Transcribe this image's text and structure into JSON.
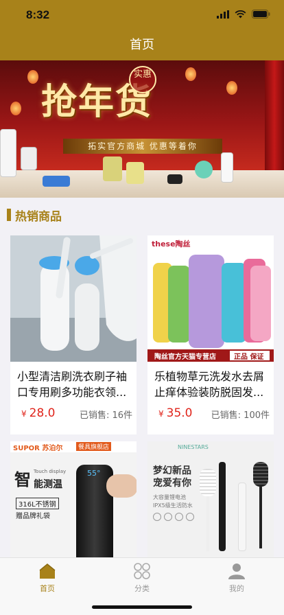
{
  "status_bar": {
    "time": "8:32"
  },
  "nav": {
    "title": "首页"
  },
  "banner": {
    "headline": "抢年货",
    "seal": "实惠",
    "ribbon": "拓实官方商城 优惠等着你"
  },
  "section": {
    "title": "热销商品"
  },
  "products": [
    {
      "name": "小型清洁刷洗衣刷子袖口专用刷多功能衣领...",
      "currency": "¥",
      "price": "28.0",
      "sold": "已销售: 16件"
    },
    {
      "name": "乐植物草元洗发水去屑止痒体验装防脱固发...",
      "currency": "¥",
      "price": "35.0",
      "sold": "已销售: 100件",
      "image_text": {
        "brand": "these陶丝",
        "store": "陶丝官方天猫专营店",
        "guarantee": "正品 保证"
      }
    },
    {
      "name": "",
      "image_text": {
        "brand": "SUPOR 苏泊尔",
        "store": "餐具旗舰店",
        "line1": "智",
        "line2": "能测温",
        "touch": "Touch display",
        "temp": "55°",
        "tag1": "316L不锈钢",
        "tag2": "赠品牌礼袋"
      }
    },
    {
      "name": "",
      "image_text": {
        "brand": "NINESTARS",
        "headline1": "梦幻新品",
        "headline2": "宠爱有你",
        "sub1": "大容量锂电池",
        "sub2": "IPX5级生活防水"
      }
    }
  ],
  "tabbar": {
    "items": [
      {
        "label": "首页",
        "icon": "home-icon",
        "active": true
      },
      {
        "label": "分类",
        "icon": "category-icon",
        "active": false
      },
      {
        "label": "我的",
        "icon": "profile-icon",
        "active": false
      }
    ]
  },
  "colors": {
    "accent": "#a8821a",
    "price": "#e0241b",
    "background": "#f2f1f6"
  }
}
